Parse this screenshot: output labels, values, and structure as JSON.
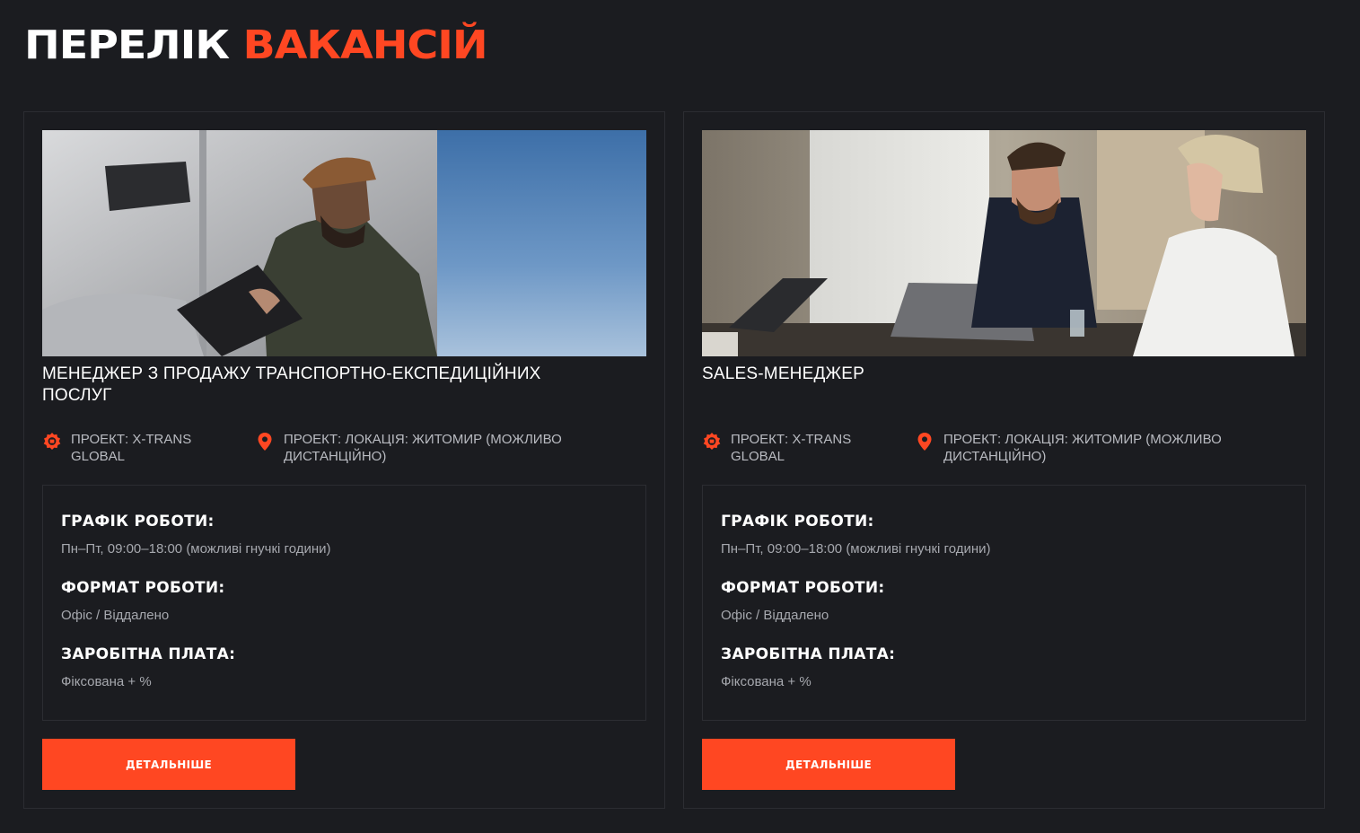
{
  "header": {
    "title_part1": "ПЕРЕЛІК",
    "title_part2": "ВАКАНСІЙ"
  },
  "colors": {
    "background": "#1b1c20",
    "accent": "#ff4722",
    "muted_text": "#a6a8ae"
  },
  "vacancies": [
    {
      "image_icon": "truck-driver-photo",
      "title": "МЕНЕДЖЕР З ПРОДАЖУ ТРАНСПОРТНО-ЕКСПЕДИЦІЙНИХ ПОСЛУГ",
      "project_icon": "gear-badge-icon",
      "project": "ПРОЕКТ: X-TRANS GLOBAL",
      "location_icon": "map-pin-icon",
      "location": "ПРОЕКТ: ЛОКАЦІЯ: ЖИТОМИР (МОЖЛИВО ДИСТАНЦІЙНО)",
      "schedule_label": "ГРАФІК РОБОТИ:",
      "schedule_value": "Пн–Пт, 09:00–18:00 (можливі гнучкі години)",
      "format_label": "ФОРМАТ РОБОТИ:",
      "format_value": "Офіс / Віддалено",
      "salary_label": "ЗАРОБІТНА ПЛАТА:",
      "salary_value": "Фіксована + %",
      "button_label": "ДЕТАЛЬНІШЕ"
    },
    {
      "image_icon": "office-meeting-photo",
      "title": "SALES-МЕНЕДЖЕР",
      "project_icon": "gear-badge-icon",
      "project": "ПРОЕКТ: X-TRANS GLOBAL",
      "location_icon": "map-pin-icon",
      "location": "ПРОЕКТ: ЛОКАЦІЯ: ЖИТОМИР (МОЖЛИВО ДИСТАНЦІЙНО)",
      "schedule_label": "ГРАФІК РОБОТИ:",
      "schedule_value": "Пн–Пт, 09:00–18:00 (можливі гнучкі години)",
      "format_label": "ФОРМАТ РОБОТИ:",
      "format_value": "Офіс / Віддалено",
      "salary_label": "ЗАРОБІТНА ПЛАТА:",
      "salary_value": "Фіксована + %",
      "button_label": "ДЕТАЛЬНІШЕ"
    }
  ]
}
